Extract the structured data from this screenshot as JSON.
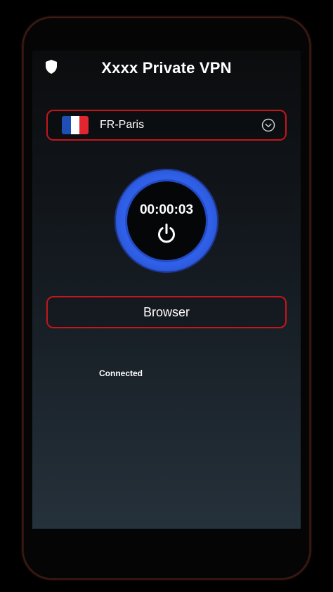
{
  "app": {
    "title": "Xxxx Private VPN"
  },
  "server": {
    "name": "FR-Paris",
    "flag_colors": [
      "#1f4fb5",
      "#ffffff",
      "#e1262f"
    ]
  },
  "connection": {
    "timer": "00:00:03",
    "status": "Connected"
  },
  "actions": {
    "browser_label": "Browser"
  },
  "colors": {
    "accent_red": "#c4161c",
    "accent_blue": "#3f73ff"
  },
  "icons": {
    "shield": "shield-icon",
    "chevron": "chevron-down-icon",
    "power": "power-icon"
  }
}
